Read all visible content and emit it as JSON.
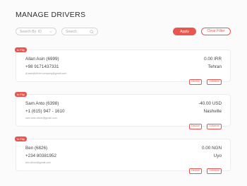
{
  "page": {
    "title": "MANAGE DRIVERS"
  },
  "filters": {
    "search_by_label": "Search By: ID",
    "search_placeholder": "Search",
    "apply_label": "Apply",
    "clear_label": "Clear Filter"
  },
  "drivers": [
    {
      "badge": "In Flip",
      "name": "Allan Asin (6999)",
      "phone": "+98 9171437331",
      "email": "al.asin@driver.company@gmail.com",
      "balance": "0.00 IRR",
      "city": "Tehran",
      "decline_label": "Decline",
      "unfreeze_label": "Unfreeze"
    },
    {
      "badge": "In Flip",
      "name": "Sam Anto (6398)",
      "phone": "+1 (615) 947 - 1610",
      "email": "sam.anto.driver@gmail.com",
      "balance": "-40.00 USD",
      "city": "Nashville",
      "decline_label": "Decline",
      "unfreeze_label": "Unfreeze"
    },
    {
      "badge": "In Flip",
      "name": "Ben (6826)",
      "phone": "+234 80381952",
      "email": "ben.driver@gmail.com",
      "balance": "0.00 NGN",
      "city": "Uyo",
      "decline_label": "Decline",
      "unfreeze_label": "Unfreeze"
    }
  ],
  "colors": {
    "accent": "#e8564f"
  },
  "icons": {
    "select": "chevron-down-icon",
    "search": "search-icon"
  }
}
